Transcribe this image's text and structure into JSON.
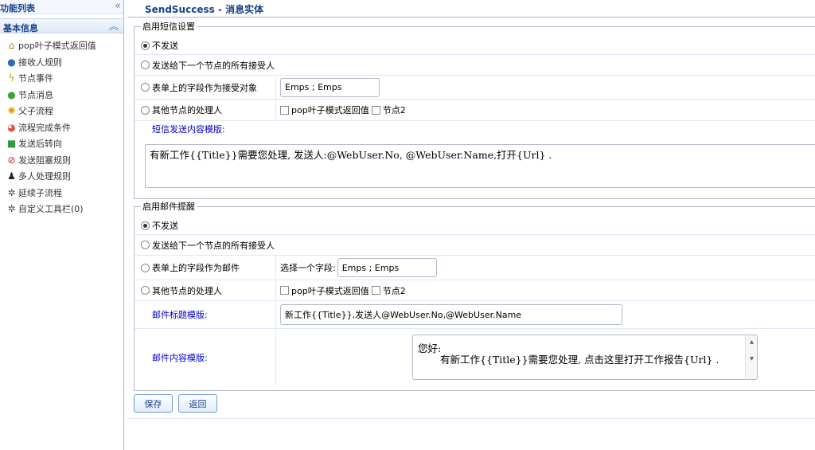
{
  "sidebar": {
    "title": "功能列表",
    "collapse_icon": "double-chevron-left-icon",
    "group": {
      "title": "基本信息",
      "toggle_icon": "double-chevron-up-icon"
    },
    "items": [
      {
        "label": "pop叶子模式返回值",
        "icon": "home-icon"
      },
      {
        "label": "接收人规则",
        "icon": "user-icon"
      },
      {
        "label": "节点事件",
        "icon": "lightning-icon"
      },
      {
        "label": "节点消息",
        "icon": "chat-icon"
      },
      {
        "label": "父子流程",
        "icon": "gear-icon"
      },
      {
        "label": "流程完成条件",
        "icon": "circle-icon"
      },
      {
        "label": "发送后转向",
        "icon": "share-icon"
      },
      {
        "label": "发送阻塞规则",
        "icon": "block-icon"
      },
      {
        "label": "多人处理规则",
        "icon": "group-icon"
      },
      {
        "label": "延续子流程",
        "icon": "gear-icon"
      },
      {
        "label": "自定义工具栏(0)",
        "icon": "gear-icon"
      }
    ]
  },
  "header": {
    "title": "SendSuccess - 消息实体"
  },
  "sms": {
    "legend": "启用短信设置",
    "opt_none": "不发送",
    "opt_next": "发送给下一个节点的所有接受人",
    "opt_field": "表单上的字段作为接受对象",
    "field_value": "Emps ; Emps",
    "opt_other": "其他节点的处理人",
    "chk_pop": "pop叶子模式返回值",
    "chk_node2": "节点2",
    "template_label": "短信发送内容模版:",
    "template_value": "有新工作{{Title}}需要您处理, 发送人:@WebUser.No, @WebUser.Name,打开{Url} ."
  },
  "mail": {
    "legend": "启用邮件提醒",
    "opt_none": "不发送",
    "opt_next": "发送给下一个节点的所有接受人",
    "opt_field": "表单上的字段作为邮件",
    "field_prompt": "选择一个字段:",
    "field_value": "Emps ; Emps",
    "opt_other": "其他节点的处理人",
    "chk_pop": "pop叶子模式返回值",
    "chk_node2": "节点2",
    "subject_label": "邮件标题模版:",
    "subject_value": "新工作{{Title}},发送人@WebUser.No,@WebUser.Name",
    "body_label": "邮件内容模版:",
    "body_line1": "您好:",
    "body_line2": "有新工作{{Title}}需要您处理, 点击这里打开工作报告{Url} ."
  },
  "buttons": {
    "save": "保存",
    "back": "返回"
  }
}
